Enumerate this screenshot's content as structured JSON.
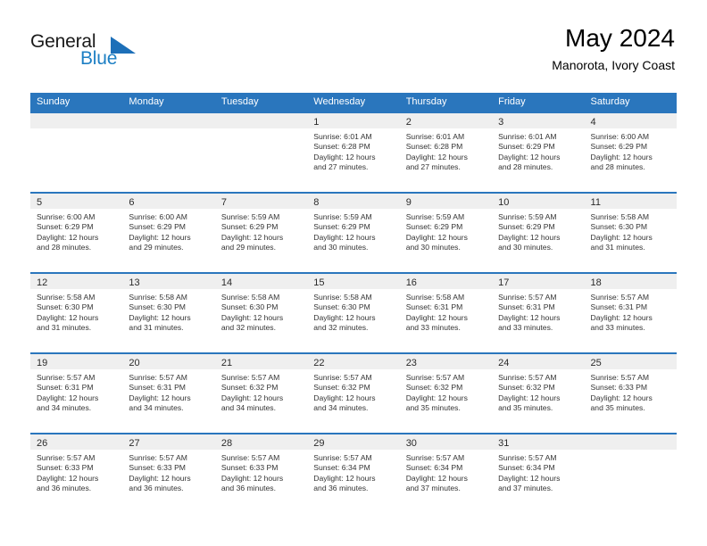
{
  "brand": {
    "name_part1": "General",
    "name_part2": "Blue",
    "triangle_icon": "triangle-right-icon",
    "accent_color": "#1d7fc4"
  },
  "header": {
    "month_title": "May 2024",
    "location": "Manorota, Ivory Coast"
  },
  "calendar": {
    "header_color": "#2a76bd",
    "weekday_headers": [
      "Sunday",
      "Monday",
      "Tuesday",
      "Wednesday",
      "Thursday",
      "Friday",
      "Saturday"
    ],
    "weeks": [
      [
        {
          "day": "",
          "lines": []
        },
        {
          "day": "",
          "lines": []
        },
        {
          "day": "",
          "lines": []
        },
        {
          "day": "1",
          "lines": [
            "Sunrise: 6:01 AM",
            "Sunset: 6:28 PM",
            "Daylight: 12 hours",
            "and 27 minutes."
          ]
        },
        {
          "day": "2",
          "lines": [
            "Sunrise: 6:01 AM",
            "Sunset: 6:28 PM",
            "Daylight: 12 hours",
            "and 27 minutes."
          ]
        },
        {
          "day": "3",
          "lines": [
            "Sunrise: 6:01 AM",
            "Sunset: 6:29 PM",
            "Daylight: 12 hours",
            "and 28 minutes."
          ]
        },
        {
          "day": "4",
          "lines": [
            "Sunrise: 6:00 AM",
            "Sunset: 6:29 PM",
            "Daylight: 12 hours",
            "and 28 minutes."
          ]
        }
      ],
      [
        {
          "day": "5",
          "lines": [
            "Sunrise: 6:00 AM",
            "Sunset: 6:29 PM",
            "Daylight: 12 hours",
            "and 28 minutes."
          ]
        },
        {
          "day": "6",
          "lines": [
            "Sunrise: 6:00 AM",
            "Sunset: 6:29 PM",
            "Daylight: 12 hours",
            "and 29 minutes."
          ]
        },
        {
          "day": "7",
          "lines": [
            "Sunrise: 5:59 AM",
            "Sunset: 6:29 PM",
            "Daylight: 12 hours",
            "and 29 minutes."
          ]
        },
        {
          "day": "8",
          "lines": [
            "Sunrise: 5:59 AM",
            "Sunset: 6:29 PM",
            "Daylight: 12 hours",
            "and 30 minutes."
          ]
        },
        {
          "day": "9",
          "lines": [
            "Sunrise: 5:59 AM",
            "Sunset: 6:29 PM",
            "Daylight: 12 hours",
            "and 30 minutes."
          ]
        },
        {
          "day": "10",
          "lines": [
            "Sunrise: 5:59 AM",
            "Sunset: 6:29 PM",
            "Daylight: 12 hours",
            "and 30 minutes."
          ]
        },
        {
          "day": "11",
          "lines": [
            "Sunrise: 5:58 AM",
            "Sunset: 6:30 PM",
            "Daylight: 12 hours",
            "and 31 minutes."
          ]
        }
      ],
      [
        {
          "day": "12",
          "lines": [
            "Sunrise: 5:58 AM",
            "Sunset: 6:30 PM",
            "Daylight: 12 hours",
            "and 31 minutes."
          ]
        },
        {
          "day": "13",
          "lines": [
            "Sunrise: 5:58 AM",
            "Sunset: 6:30 PM",
            "Daylight: 12 hours",
            "and 31 minutes."
          ]
        },
        {
          "day": "14",
          "lines": [
            "Sunrise: 5:58 AM",
            "Sunset: 6:30 PM",
            "Daylight: 12 hours",
            "and 32 minutes."
          ]
        },
        {
          "day": "15",
          "lines": [
            "Sunrise: 5:58 AM",
            "Sunset: 6:30 PM",
            "Daylight: 12 hours",
            "and 32 minutes."
          ]
        },
        {
          "day": "16",
          "lines": [
            "Sunrise: 5:58 AM",
            "Sunset: 6:31 PM",
            "Daylight: 12 hours",
            "and 33 minutes."
          ]
        },
        {
          "day": "17",
          "lines": [
            "Sunrise: 5:57 AM",
            "Sunset: 6:31 PM",
            "Daylight: 12 hours",
            "and 33 minutes."
          ]
        },
        {
          "day": "18",
          "lines": [
            "Sunrise: 5:57 AM",
            "Sunset: 6:31 PM",
            "Daylight: 12 hours",
            "and 33 minutes."
          ]
        }
      ],
      [
        {
          "day": "19",
          "lines": [
            "Sunrise: 5:57 AM",
            "Sunset: 6:31 PM",
            "Daylight: 12 hours",
            "and 34 minutes."
          ]
        },
        {
          "day": "20",
          "lines": [
            "Sunrise: 5:57 AM",
            "Sunset: 6:31 PM",
            "Daylight: 12 hours",
            "and 34 minutes."
          ]
        },
        {
          "day": "21",
          "lines": [
            "Sunrise: 5:57 AM",
            "Sunset: 6:32 PM",
            "Daylight: 12 hours",
            "and 34 minutes."
          ]
        },
        {
          "day": "22",
          "lines": [
            "Sunrise: 5:57 AM",
            "Sunset: 6:32 PM",
            "Daylight: 12 hours",
            "and 34 minutes."
          ]
        },
        {
          "day": "23",
          "lines": [
            "Sunrise: 5:57 AM",
            "Sunset: 6:32 PM",
            "Daylight: 12 hours",
            "and 35 minutes."
          ]
        },
        {
          "day": "24",
          "lines": [
            "Sunrise: 5:57 AM",
            "Sunset: 6:32 PM",
            "Daylight: 12 hours",
            "and 35 minutes."
          ]
        },
        {
          "day": "25",
          "lines": [
            "Sunrise: 5:57 AM",
            "Sunset: 6:33 PM",
            "Daylight: 12 hours",
            "and 35 minutes."
          ]
        }
      ],
      [
        {
          "day": "26",
          "lines": [
            "Sunrise: 5:57 AM",
            "Sunset: 6:33 PM",
            "Daylight: 12 hours",
            "and 36 minutes."
          ]
        },
        {
          "day": "27",
          "lines": [
            "Sunrise: 5:57 AM",
            "Sunset: 6:33 PM",
            "Daylight: 12 hours",
            "and 36 minutes."
          ]
        },
        {
          "day": "28",
          "lines": [
            "Sunrise: 5:57 AM",
            "Sunset: 6:33 PM",
            "Daylight: 12 hours",
            "and 36 minutes."
          ]
        },
        {
          "day": "29",
          "lines": [
            "Sunrise: 5:57 AM",
            "Sunset: 6:34 PM",
            "Daylight: 12 hours",
            "and 36 minutes."
          ]
        },
        {
          "day": "30",
          "lines": [
            "Sunrise: 5:57 AM",
            "Sunset: 6:34 PM",
            "Daylight: 12 hours",
            "and 37 minutes."
          ]
        },
        {
          "day": "31",
          "lines": [
            "Sunrise: 5:57 AM",
            "Sunset: 6:34 PM",
            "Daylight: 12 hours",
            "and 37 minutes."
          ]
        },
        {
          "day": "",
          "lines": []
        }
      ]
    ]
  }
}
